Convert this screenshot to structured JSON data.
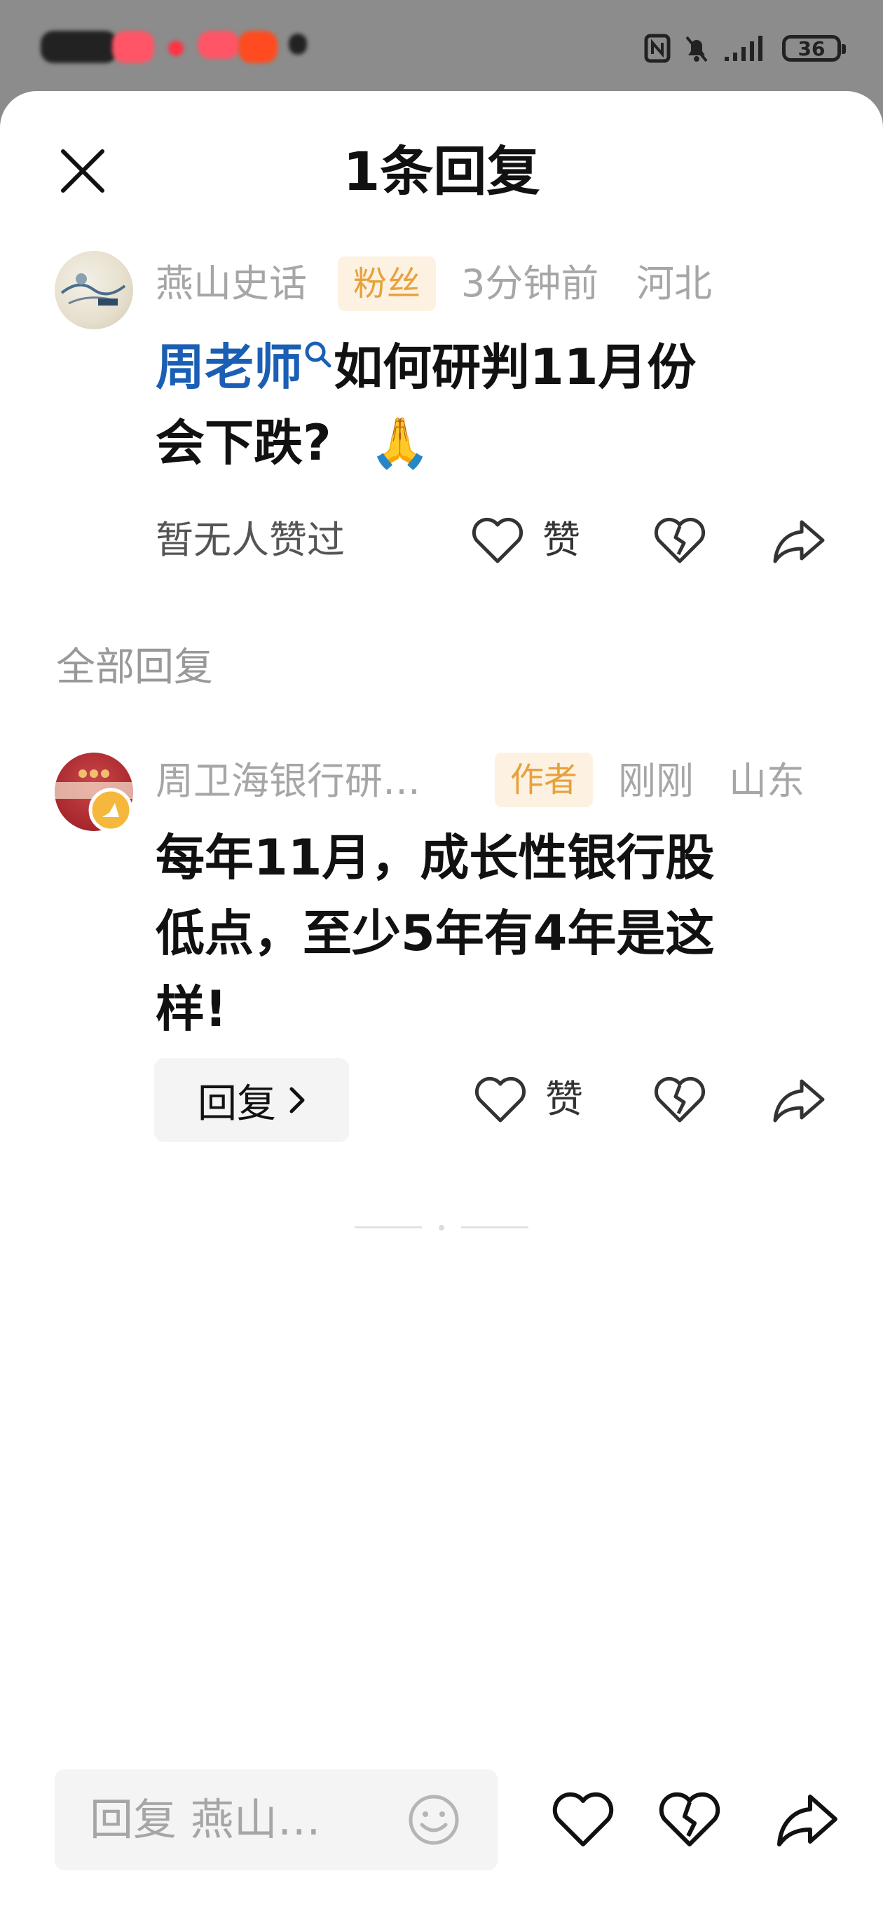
{
  "status_bar": {
    "battery_level": "36"
  },
  "header": {
    "title": "1条回复",
    "close_icon": "close-icon"
  },
  "main_comment": {
    "author": "燕山史话",
    "badge": "粉丝",
    "time": "3分钟前",
    "location": "河北",
    "mention": "周老师",
    "text_line1": "如何研判11月份",
    "text_line2": "会下跌?",
    "emoji": "🙏",
    "likes_status": "暂无人赞过",
    "like_label": "赞"
  },
  "replies_section": {
    "title": "全部回复"
  },
  "reply": {
    "author": "周卫海银行研…",
    "badge": "作者",
    "time": "刚刚",
    "location": "山东",
    "text_line1": "每年11月，成长性银行股",
    "text_line2": "低点，至少5年有4年是这",
    "text_line3": "样!",
    "reply_button": "回复",
    "like_label": "赞"
  },
  "bottom_bar": {
    "input_placeholder": "回复 燕山…",
    "emoji_icon": "smiley-icon"
  },
  "colors": {
    "accent_mention": "#1a5fb4",
    "badge_bg": "#fdf1e1",
    "badge_text": "#e6a23c",
    "meta_gray": "#a6a6a6"
  }
}
